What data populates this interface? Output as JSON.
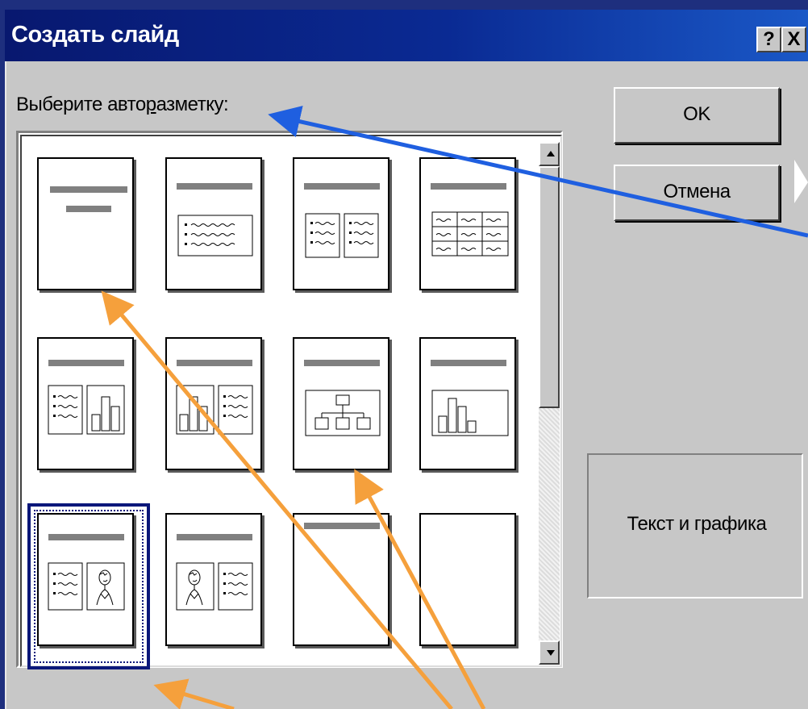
{
  "dialog": {
    "title": "Создать слайд",
    "help_label": "?",
    "close_label": "X"
  },
  "prompt": {
    "before": "Выберите авто",
    "accel": "р",
    "after": "азметку:"
  },
  "buttons": {
    "ok_label": "OK",
    "cancel_label": "Отмена"
  },
  "preview": {
    "label": "Текст и графика"
  },
  "layouts": [
    {
      "id": "title"
    },
    {
      "id": "bulleted-list"
    },
    {
      "id": "two-column-text"
    },
    {
      "id": "table"
    },
    {
      "id": "text-and-chart"
    },
    {
      "id": "chart-and-text"
    },
    {
      "id": "organization-chart"
    },
    {
      "id": "chart"
    },
    {
      "id": "text-and-clip-art",
      "selected": true
    },
    {
      "id": "clip-art-and-text"
    },
    {
      "id": "title-only"
    },
    {
      "id": "blank"
    }
  ],
  "colors": {
    "title_bar": "#08186f",
    "dialog_bg": "#c7c7c7",
    "arrow_orange": "#f5a03c",
    "arrow_blue": "#1f5fe0",
    "selection": "#0a177a"
  }
}
